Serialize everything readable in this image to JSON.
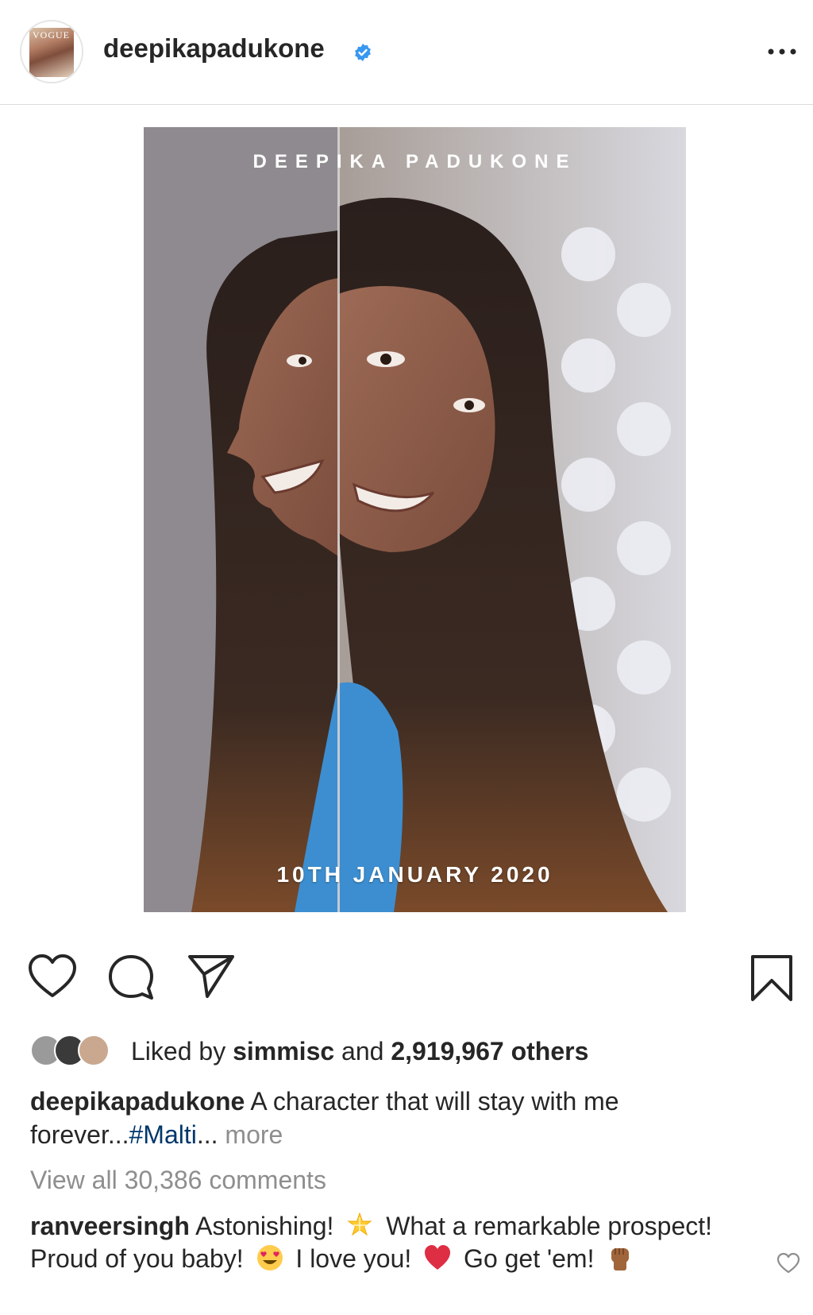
{
  "header": {
    "username": "deepikapadukone",
    "avatar_text": "VOGUE",
    "verified_color": "#3897f0"
  },
  "poster": {
    "top_text": "DEEPIKA PADUKONE",
    "date_text": "10TH JANUARY 2020"
  },
  "actions": {
    "icons": [
      "heart-icon",
      "comment-icon",
      "share-icon",
      "bookmark-icon"
    ]
  },
  "likes": {
    "prefix": "Liked by ",
    "user": "simmisc",
    "middle": " and ",
    "count": "2,919,967 others"
  },
  "caption": {
    "username": "deepikapadukone",
    "text": "A character that will stay with me forever...",
    "hashtag": "#Malti",
    "ellipsis": "...",
    "more": "more"
  },
  "comments": {
    "view_all": "View all 30,386 comments",
    "top_comment": {
      "username": "ranveersingh",
      "part1": "Astonishing!",
      "part2": "What a remarkable prospect! Proud of you baby!",
      "part3": "I love you!",
      "part4": "Go get 'em!"
    }
  }
}
